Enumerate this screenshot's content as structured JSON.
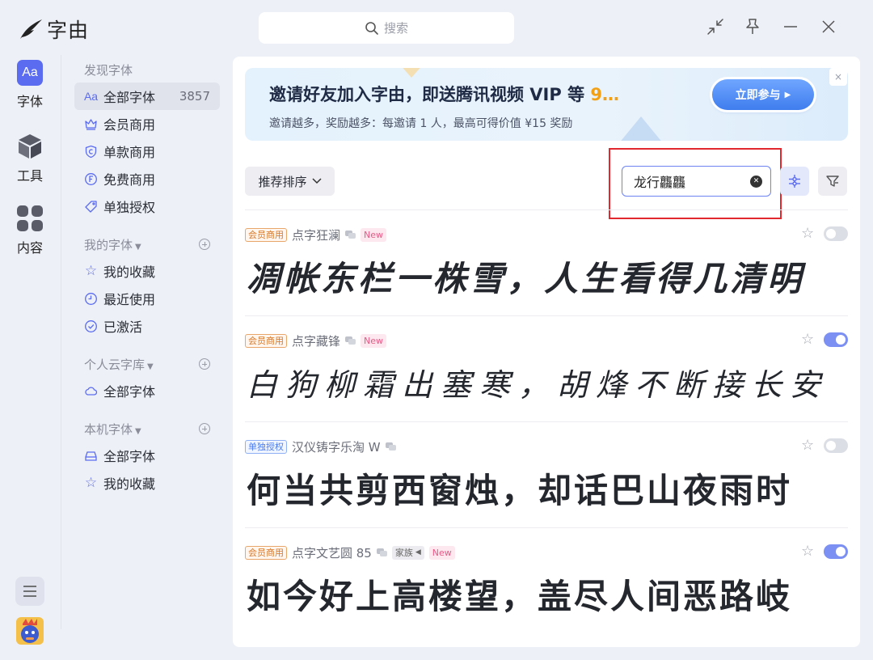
{
  "app": {
    "name": "字由"
  },
  "search": {
    "placeholder": "搜索"
  },
  "rail": [
    {
      "label": "字体",
      "icon": "aa-icon",
      "badge": "Aa"
    },
    {
      "label": "工具",
      "icon": "cube-icon"
    },
    {
      "label": "内容",
      "icon": "grid-icon"
    }
  ],
  "sidebar": {
    "discover": {
      "title": "发现字体",
      "items": [
        {
          "label": "全部字体",
          "icon": "Aa",
          "count": "3857"
        },
        {
          "label": "会员商用",
          "icon": "crown-icon"
        },
        {
          "label": "单款商用",
          "icon": "shield-icon"
        },
        {
          "label": "免费商用",
          "icon": "free-icon"
        },
        {
          "label": "单独授权",
          "icon": "tag-icon"
        }
      ]
    },
    "mine": {
      "title": "我的字体",
      "items": [
        {
          "label": "我的收藏",
          "icon": "star-icon"
        },
        {
          "label": "最近使用",
          "icon": "clock-icon"
        },
        {
          "label": "已激活",
          "icon": "check-circle-icon"
        }
      ]
    },
    "cloud": {
      "title": "个人云字库",
      "items": [
        {
          "label": "全部字体",
          "icon": "cloud-icon"
        }
      ]
    },
    "local": {
      "title": "本机字体",
      "items": [
        {
          "label": "全部字体",
          "icon": "drive-icon"
        },
        {
          "label": "我的收藏",
          "icon": "star-icon"
        }
      ]
    }
  },
  "banner": {
    "title_main": "邀请好友加入字由，即送腾讯视频 VIP 等 ",
    "title_highlight": "9…",
    "subtitle": "邀请越多，奖励越多：每邀请 1 人，最高可得价值 ¥15 奖励",
    "button": "立即参与",
    "close": "×"
  },
  "toolbar": {
    "sort_label": "推荐排序",
    "font_search_value": "龙行龘龘"
  },
  "fonts": [
    {
      "tag": "会员商用",
      "tag_type": "vip",
      "name": "点字狂澜",
      "extra": "",
      "family": "",
      "is_new": "New",
      "preview": "凋帐东栏一株雪，人生看得几清明",
      "active": false
    },
    {
      "tag": "会员商用",
      "tag_type": "vip",
      "name": "点字藏锋",
      "extra": "",
      "family": "",
      "is_new": "New",
      "preview": "白狗柳霜出塞寒，胡烽不断接长安",
      "active": true
    },
    {
      "tag": "单独授权",
      "tag_type": "single",
      "name": "汉仪铸字乐淘 W",
      "extra": "",
      "family": "",
      "is_new": "",
      "preview": "何当共剪西窗烛，却话巴山夜雨时",
      "active": false
    },
    {
      "tag": "会员商用",
      "tag_type": "vip",
      "name": "点字文艺圆 85",
      "extra": "",
      "family": "家族",
      "is_new": "New",
      "preview": "如今好上高楼望，盖尽人间恶路岐",
      "active": true
    }
  ],
  "colors": {
    "accent": "#5b6cf0",
    "highlight_box": "#e0282e",
    "banner_highlight": "#f2a015"
  }
}
